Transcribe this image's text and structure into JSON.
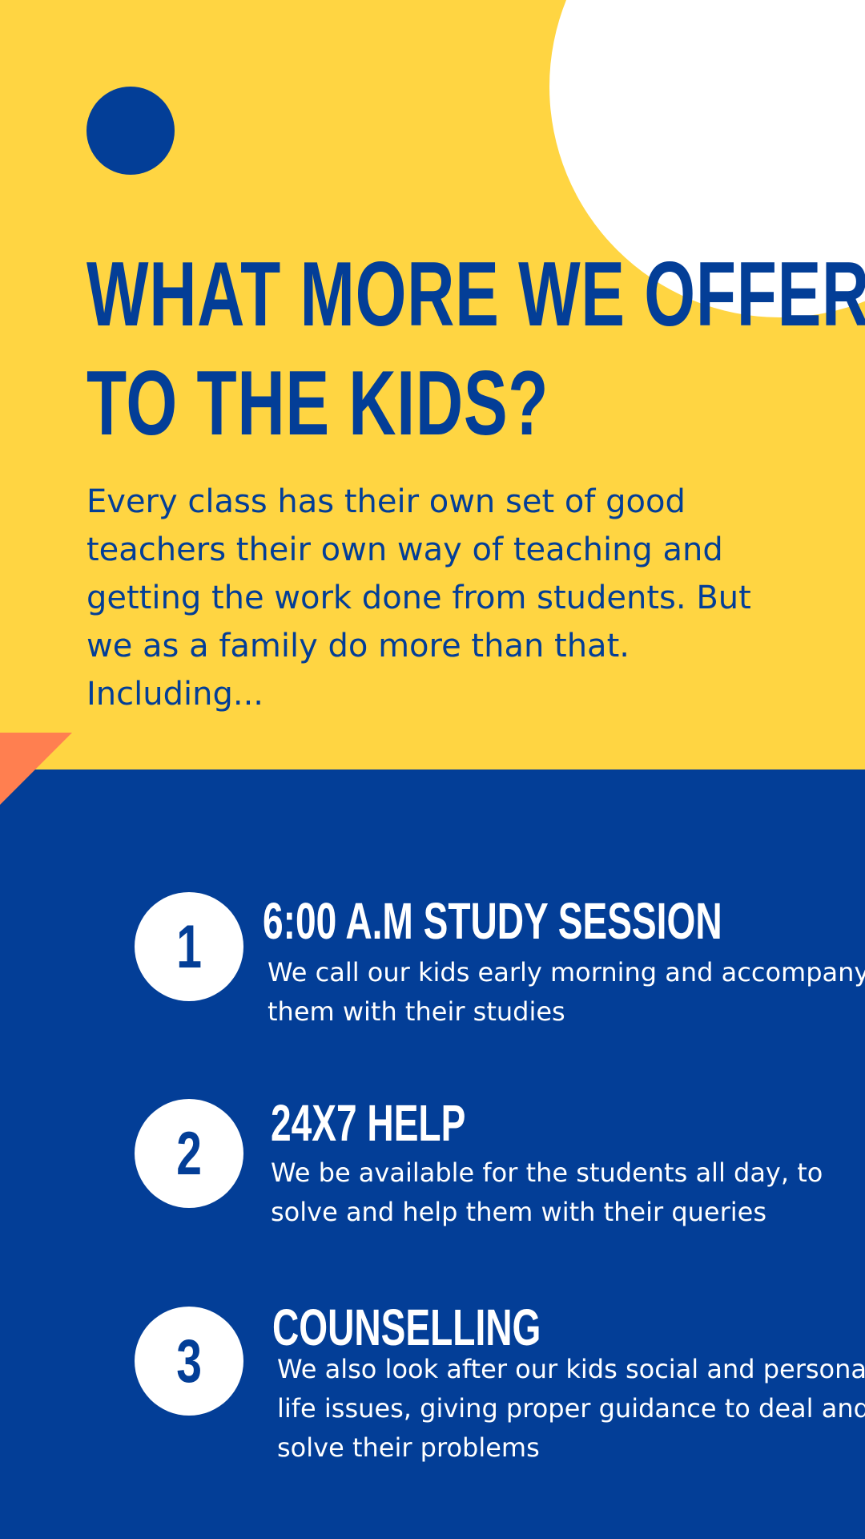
{
  "headline": {
    "line1": "WHAT MORE WE OFFER",
    "line2": "TO THE KIDS?"
  },
  "intro": "Every class has their own set of good teachers their own way of teaching and getting the work done from students. But we as a family do more than that. Including...",
  "items": [
    {
      "number": "1",
      "title": "6:00 A.M STUDY SESSION",
      "description": "We call our kids early morning and accompany them with their studies"
    },
    {
      "number": "2",
      "title": "24X7 HELP",
      "description": "We be available for the students all day, to solve and help them with their queries"
    },
    {
      "number": "3",
      "title": "COUNSELLING",
      "description": "We also look after our kids social and personal life issues, giving proper guidance to deal and solve their problems"
    }
  ],
  "colors": {
    "yellow": "#FFD542",
    "blue": "#033E97",
    "white": "#FFFFFF",
    "orange": "#FF7F50"
  }
}
